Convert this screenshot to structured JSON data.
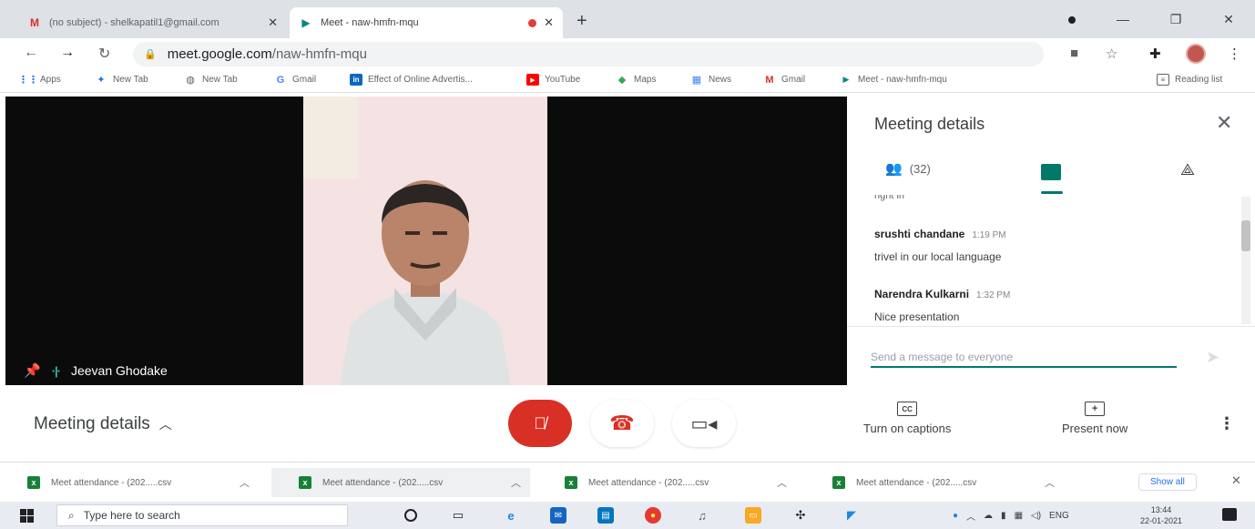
{
  "browser": {
    "tabs": [
      {
        "title": "(no subject) - shelkapatil1@gmail.com",
        "favicon": "gmail-icon",
        "close": "✕"
      },
      {
        "title": "Meet - naw-hmfn-mqu",
        "favicon": "meet-icon",
        "close": "✕"
      }
    ],
    "new_tab_label": "+",
    "url_host": "meet.google.com",
    "url_path": "/naw-hmfn-mqu",
    "bookmarks": [
      {
        "label": "Apps",
        "icon": "apps-grid-icon",
        "color": "#1a73e8",
        "glyph": "⋮⋮"
      },
      {
        "label": "New Tab",
        "icon": "chrome-icon",
        "color": "#1a73e8",
        "glyph": "✦"
      },
      {
        "label": "New Tab",
        "icon": "globe-icon",
        "color": "#5f6368",
        "glyph": "◍"
      },
      {
        "label": "Gmail",
        "icon": "google-icon",
        "color": "#4285f4",
        "glyph": "G"
      },
      {
        "label": "Effect of Online Advertis...",
        "icon": "linkedin-icon",
        "color": "#0a66c2",
        "glyph": "in"
      },
      {
        "label": "YouTube",
        "icon": "youtube-icon",
        "color": "#ff0000",
        "glyph": "▶"
      },
      {
        "label": "Maps",
        "icon": "maps-icon",
        "color": "#34a853",
        "glyph": "◆"
      },
      {
        "label": "News",
        "icon": "news-icon",
        "color": "#4285f4",
        "glyph": "▦"
      },
      {
        "label": "Gmail",
        "icon": "gmail-icon",
        "color": "#d93025",
        "glyph": "M"
      },
      {
        "label": "Meet - naw-hmfn-mqu",
        "icon": "meet-icon",
        "color": "#00897b",
        "glyph": "▶"
      }
    ],
    "reading_list_label": "Reading list"
  },
  "stage": {
    "participant_name": "Jeevan Ghodake"
  },
  "panel": {
    "title": "Meeting details",
    "people_count": "(32)",
    "truncated_message": "right in",
    "messages": [
      {
        "sender": "srushti chandane",
        "time": "1:19 PM",
        "text": "trivel in our local language"
      },
      {
        "sender": "Narendra Kulkarni",
        "time": "1:32 PM",
        "text": "Nice presentation"
      }
    ],
    "input_placeholder": "Send a message to everyone"
  },
  "controls": {
    "meeting_details_label": "Meeting details",
    "captions_label": "Turn on captions",
    "present_label": "Present now"
  },
  "downloads": {
    "items": [
      {
        "name": "Meet attendance - (202.....csv"
      },
      {
        "name": "Meet attendance - (202.....csv"
      },
      {
        "name": "Meet attendance - (202.....csv"
      },
      {
        "name": "Meet attendance - (202.....csv"
      }
    ],
    "show_all_label": "Show all"
  },
  "taskbar": {
    "search_placeholder": "Type here to search",
    "language": "ENG",
    "time": "13:44",
    "date": "22-01-2021"
  },
  "colors": {
    "accent_teal": "#00796b",
    "end_call_red": "#d93025",
    "video_tile_black": "#0b0b0b"
  }
}
